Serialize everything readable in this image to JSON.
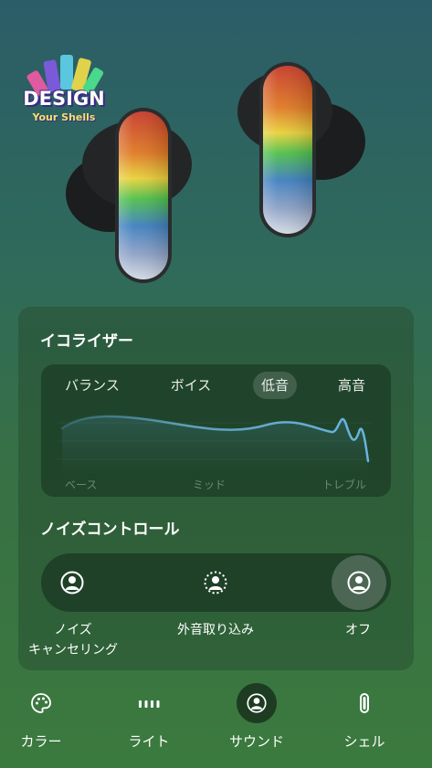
{
  "hero": {
    "logo_line1": "DESIGN",
    "logo_line2": "Your Shells"
  },
  "equalizer": {
    "title": "イコライザー",
    "tabs": [
      {
        "label": "バランス",
        "active": false
      },
      {
        "label": "ボイス",
        "active": false
      },
      {
        "label": "低音",
        "active": true
      },
      {
        "label": "高音",
        "active": false
      }
    ],
    "axis": [
      "ベース",
      "ミッド",
      "トレブル"
    ]
  },
  "noise_control": {
    "title": "ノイズコントロール",
    "options": [
      {
        "label_line1": "ノイズ",
        "label_line2": "キャンセリング",
        "icon": "noise-cancel-icon",
        "active": false
      },
      {
        "label_line1": "外音取り込み",
        "label_line2": "",
        "icon": "ambient-icon",
        "active": false
      },
      {
        "label_line1": "オフ",
        "label_line2": "",
        "icon": "noise-off-icon",
        "active": true
      }
    ]
  },
  "nav": {
    "items": [
      {
        "label": "カラー",
        "icon": "palette-icon",
        "active": false
      },
      {
        "label": "ライト",
        "icon": "light-icon",
        "active": false
      },
      {
        "label": "サウンド",
        "icon": "sound-icon",
        "active": true
      },
      {
        "label": "シェル",
        "icon": "shell-icon",
        "active": false
      }
    ]
  },
  "colors": {
    "bg_top": "#2b5d68",
    "bg_bottom": "#3b7a3e",
    "accent_curve": "#5aa9d6"
  }
}
